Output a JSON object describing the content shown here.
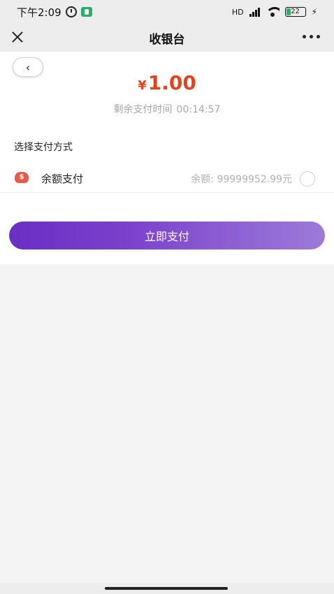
{
  "status_bar": {
    "time": "下午2:09",
    "network": "HD",
    "battery": "22"
  },
  "navbar": {
    "title": "收银台"
  },
  "payment": {
    "currency_symbol": "¥",
    "amount": "1.00",
    "countdown_label": "剩余支付时间",
    "countdown_time": "00:14:57",
    "section_title": "选择支付方式",
    "method_label": "余额支付",
    "balance_text": "余额: 99999952.99元",
    "method_selected": false,
    "pay_button_label": "立即支付"
  },
  "colors": {
    "amount": "#e0441e",
    "button_start": "#6a2fc4",
    "button_end": "#9c7bd8",
    "wallet_icon": "#e85b4b"
  },
  "icons": [
    "alarm-icon",
    "wechat-icon",
    "signal-icon",
    "wifi-icon",
    "battery-icon",
    "close-icon",
    "more-icon",
    "back-arrow-icon",
    "wallet-icon",
    "radio-icon"
  ]
}
